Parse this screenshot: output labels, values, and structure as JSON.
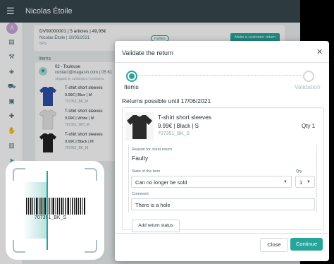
{
  "app": {
    "user_name": "Nicolas Étoile",
    "avatar_letter": "A",
    "menu_icon": "hamburger-menu-icon"
  },
  "order": {
    "title": "DV00000001 | 5 articles | 49,95€",
    "customer": "Nicolas Étoile | 10/05/2021",
    "ref": "SFS",
    "status": "Fulfilled",
    "make_return_label": "Make a customer return"
  },
  "background": {
    "items_label": "Items",
    "store_name": "02 - Toulouse",
    "store_email": "contact@magasin.com | 05 61",
    "store_shipped": "Shipped on 11/05/2021 | Colissimo",
    "items": [
      {
        "name": "T-shirt short sleeves",
        "price": "9.99€ | Blue | M",
        "sku": "707351_BK_M",
        "color": "#2f4fa8"
      },
      {
        "name": "T-shirt short sleeves",
        "price": "9.99€ | White | M",
        "sku": "707351_WH_M",
        "color": "#e6e6e6"
      },
      {
        "name": "T-shirt short sleeves",
        "price": "9.99€ | Black | M",
        "sku": "707351_BK_M",
        "color": "#222222"
      }
    ]
  },
  "modal": {
    "title": "Validate the return",
    "close_icon": "close-icon",
    "steps": [
      {
        "label": "Items",
        "active": true
      },
      {
        "label": "Validation",
        "active": false
      }
    ],
    "returns_until": "Returns possible until 17/06/2021",
    "product": {
      "name": "T-shirt short sleeves",
      "price_line": "9.99€ | Black | S",
      "sku": "707351_BK_S",
      "qty": "Qty 1"
    },
    "reason": {
      "label": "Reason for client return",
      "value": "Faulty"
    },
    "state": {
      "label": "State of the item",
      "value": "Can no longer be sold"
    },
    "qty": {
      "label": "Qty",
      "value": "1"
    },
    "comment": {
      "label": "Comment",
      "value": "There is a hole"
    },
    "add_status_label": "Add return status",
    "close_label": "Close",
    "continue_label": "Continue"
  },
  "scanner": {
    "barcode_text": "707351_BK_S"
  },
  "colors": {
    "accent": "#26a69a",
    "topbar": "#37474f"
  }
}
